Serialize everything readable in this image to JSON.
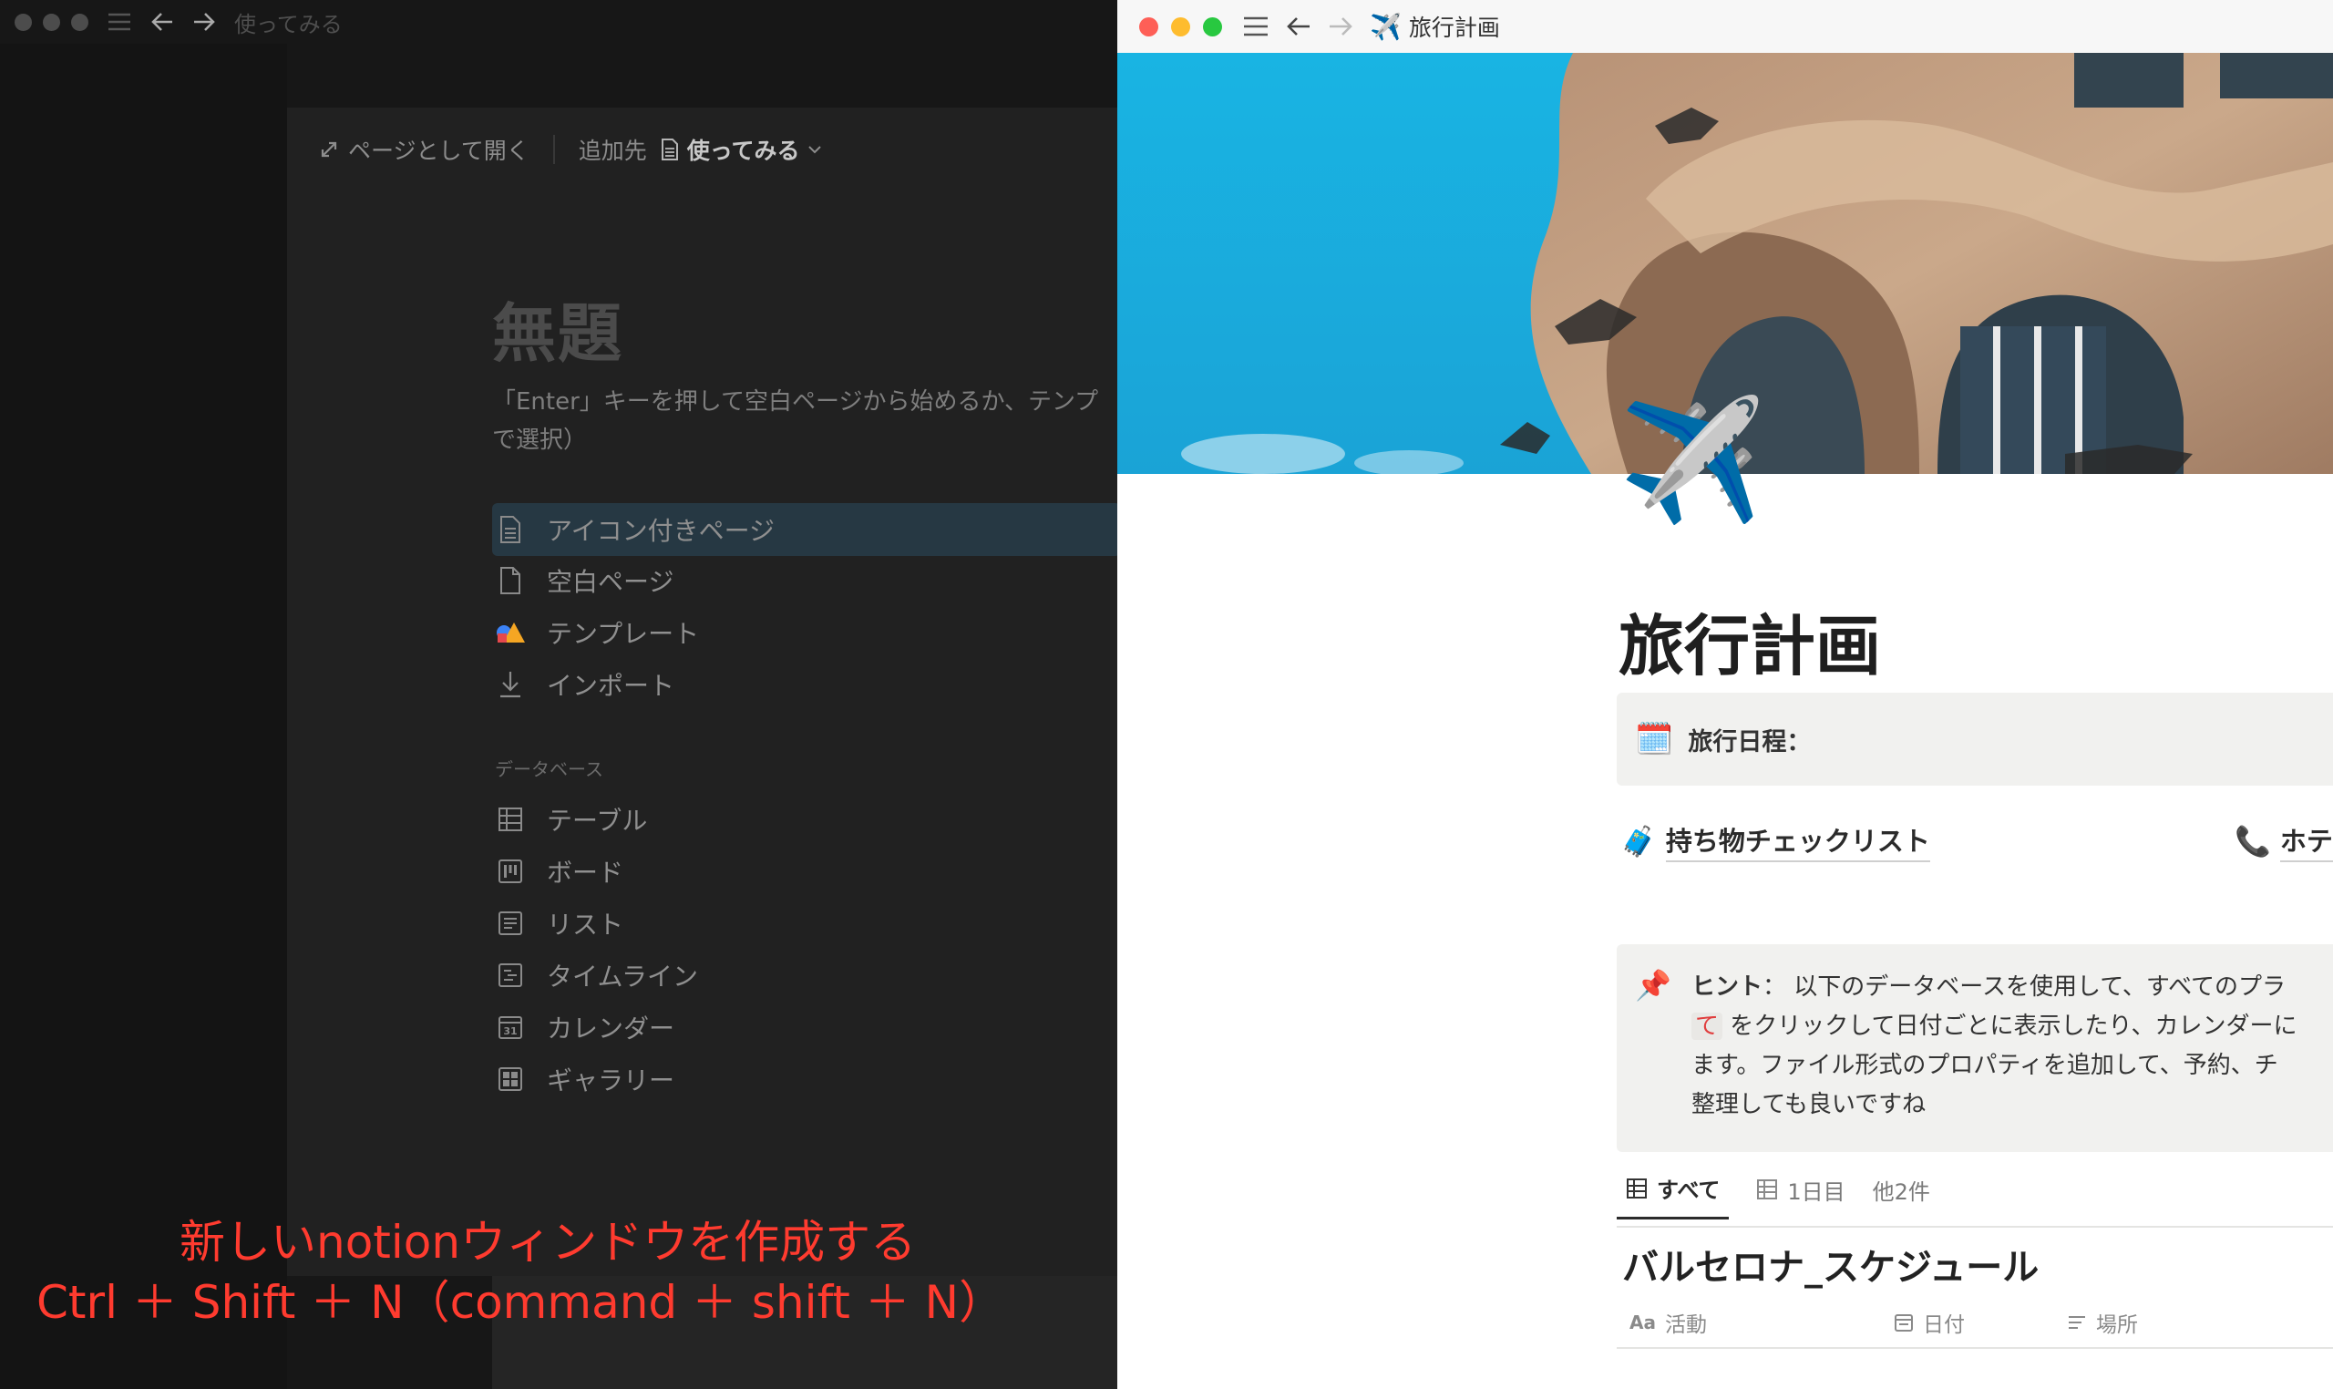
{
  "left_window": {
    "title": "使ってみる",
    "toolbar": {
      "open_as_page_label": "ページとして開く",
      "add_to_label": "追加先",
      "destination_page": "使ってみる"
    },
    "page": {
      "title_placeholder": "無題",
      "hint_line1": "「Enter」キーを押して空白ページから始めるか、テンプ",
      "hint_line2": "で選択）"
    },
    "menu_items": [
      {
        "label": "アイコン付きページ",
        "icon": "document-icon"
      },
      {
        "label": "空白ページ",
        "icon": "blank-page-icon"
      },
      {
        "label": "テンプレート",
        "icon": "shapes-icon"
      },
      {
        "label": "インポート",
        "icon": "download-arrow-icon"
      }
    ],
    "database_heading": "データベース",
    "database_items": [
      {
        "label": "テーブル",
        "icon": "table-icon"
      },
      {
        "label": "ボード",
        "icon": "board-icon"
      },
      {
        "label": "リスト",
        "icon": "list-icon"
      },
      {
        "label": "タイムライン",
        "icon": "timeline-icon"
      },
      {
        "label": "カレンダー",
        "icon": "calendar-icon"
      },
      {
        "label": "ギャラリー",
        "icon": "gallery-icon"
      }
    ]
  },
  "right_window": {
    "title": "旅行計画",
    "title_emoji": "✈️",
    "page": {
      "icon": "✈️",
      "title": "旅行計画",
      "date_callout_icon": "🗓️",
      "date_callout_label": "旅行日程：",
      "links": [
        {
          "emoji": "🧳",
          "label": "持ち物チェックリスト"
        },
        {
          "emoji": "📞",
          "label": "ホテ"
        }
      ],
      "hint_callout": {
        "icon": "📌",
        "label": "ヒント",
        "line1": "：  以下のデータベースを使用して、すべてのプラ",
        "line2_prefix": "て",
        "line2_rest": " をクリックして日付ごとに表示したり、カレンダーに",
        "line3": "ます。ファイル形式のプロパティを追加して、予約、チ",
        "line4": "整理しても良いですね"
      },
      "view_tabs": [
        {
          "label": "すべて",
          "active": true
        },
        {
          "label": "1日目",
          "active": false
        },
        {
          "label": "他2件",
          "active": false
        }
      ],
      "database_title": "バルセロナ_スケジュール",
      "properties": [
        {
          "label": "活動",
          "icon": "text-aa-icon"
        },
        {
          "label": "日付",
          "icon": "calendar-icon"
        },
        {
          "label": "場所",
          "icon": "lines-icon"
        }
      ]
    }
  },
  "caption": {
    "line1": "新しいnotionウィンドウを作成する",
    "line2": "Ctrl ＋ Shift ＋ N（command ＋ shift ＋ N）"
  },
  "colors": {
    "caption_red": "#ff3b2f",
    "mac_close": "#fe5f57",
    "mac_minimize": "#febc2e",
    "mac_zoom": "#28c840",
    "selection_highlight": "#263843"
  }
}
